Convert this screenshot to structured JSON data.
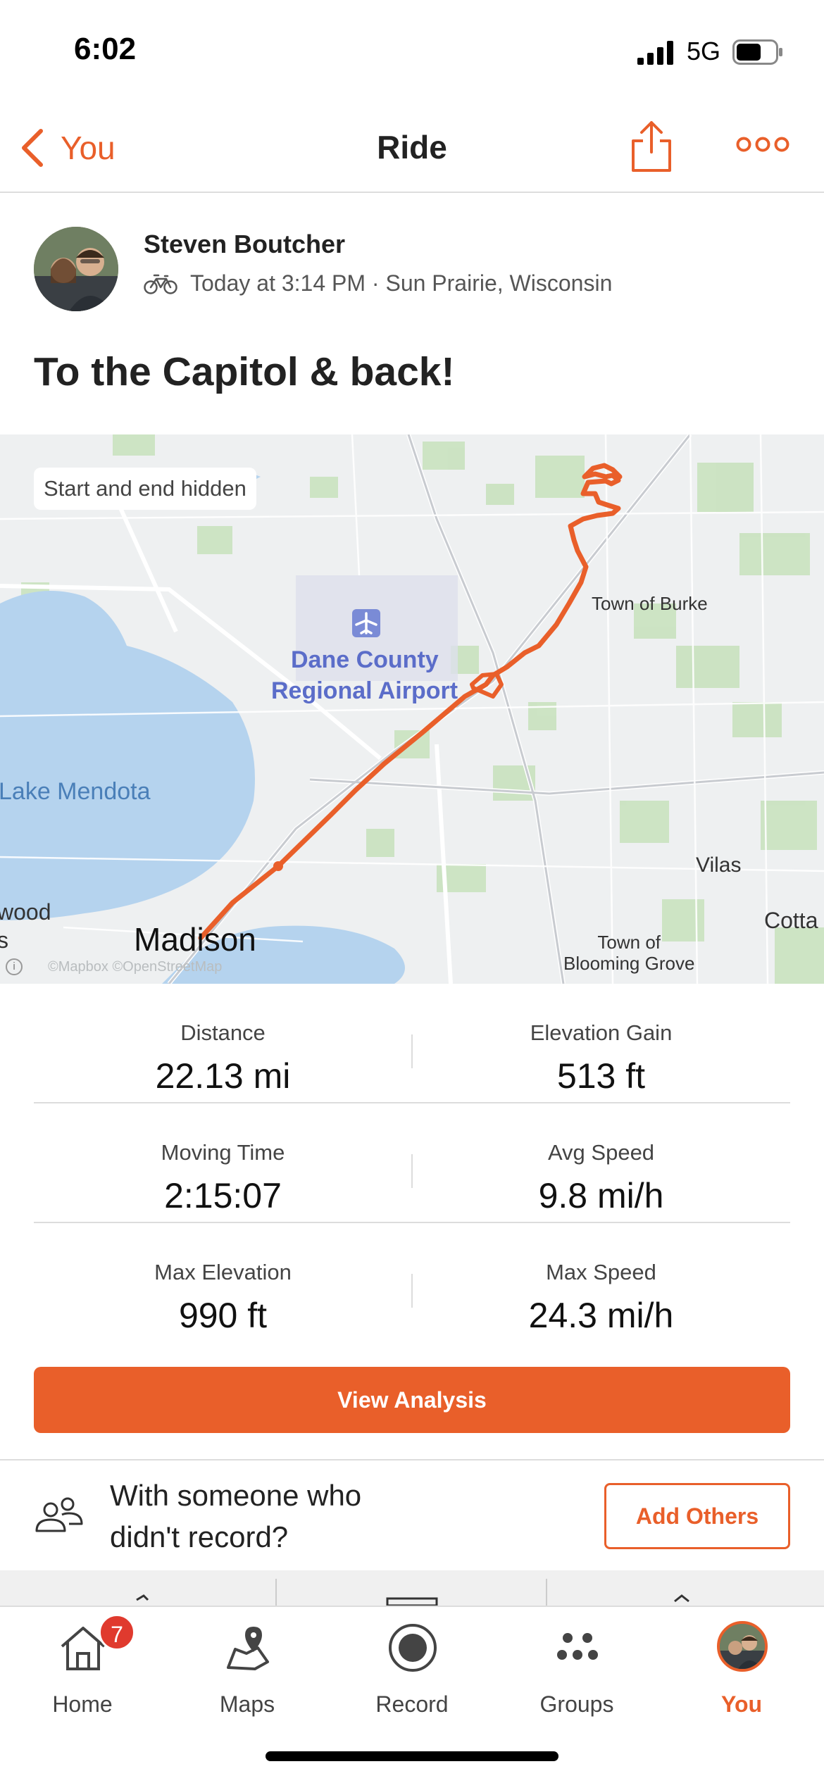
{
  "status_bar": {
    "time": "6:02",
    "network": "5G"
  },
  "nav": {
    "back_label": "You",
    "title": "Ride"
  },
  "athlete": {
    "name": "Steven Boutcher",
    "meta": "Today at 3:14 PM · Sun Prairie, Wisconsin"
  },
  "activity": {
    "title": "To the Capitol & back!"
  },
  "map": {
    "privacy_chip": "Start and end hidden",
    "labels": {
      "airport_line1": "Dane County",
      "airport_line2": "Regional Airport",
      "burke": "Town of Burke",
      "mendota": "Lake Mendota",
      "vilas": "Vilas",
      "madison": "Madison",
      "blooming_grove_line1": "Town of",
      "blooming_grove_line2": "Blooming Grove",
      "cotta": "Cotta",
      "wood": "wood",
      "s": "s"
    },
    "attribution": "©Mapbox ©OpenStreetMap",
    "route_color": "#e95f2a"
  },
  "stats": [
    {
      "left": {
        "label": "Distance",
        "value": "22.13 mi"
      },
      "right": {
        "label": "Elevation Gain",
        "value": "513 ft"
      }
    },
    {
      "left": {
        "label": "Moving Time",
        "value": "2:15:07"
      },
      "right": {
        "label": "Avg Speed",
        "value": "9.8 mi/h"
      }
    },
    {
      "left": {
        "label": "Max Elevation",
        "value": "990 ft"
      },
      "right": {
        "label": "Max Speed",
        "value": "24.3 mi/h"
      }
    }
  ],
  "actions": {
    "view_analysis": "View Analysis",
    "with_someone_line1": "With someone who",
    "with_someone_line2": "didn't record?",
    "add_others": "Add Others"
  },
  "tabbar": {
    "tabs": [
      {
        "label": "Home",
        "icon": "home-icon",
        "badge": "7"
      },
      {
        "label": "Maps",
        "icon": "maps-icon"
      },
      {
        "label": "Record",
        "icon": "record-icon"
      },
      {
        "label": "Groups",
        "icon": "groups-icon"
      },
      {
        "label": "You",
        "icon": "avatar"
      }
    ]
  },
  "colors": {
    "accent": "#e95f2a",
    "badge": "#e03a2e"
  }
}
